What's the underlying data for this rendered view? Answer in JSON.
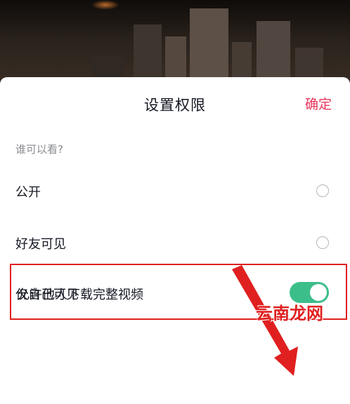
{
  "sheet": {
    "title": "设置权限",
    "confirm_label": "确定",
    "section_label": "谁可以看?",
    "options": [
      {
        "label": "公开",
        "selected": false
      },
      {
        "label": "好友可见",
        "selected": false
      },
      {
        "label": "仅自己可见",
        "selected": true
      }
    ],
    "download_toggle": {
      "label": "允许他人下载完整视频",
      "on": true
    }
  },
  "colors": {
    "accent": "#e8365a",
    "toggle_on": "#3cbe8a",
    "highlight": "#e02020"
  },
  "watermark": {
    "text": "云南龙网"
  }
}
